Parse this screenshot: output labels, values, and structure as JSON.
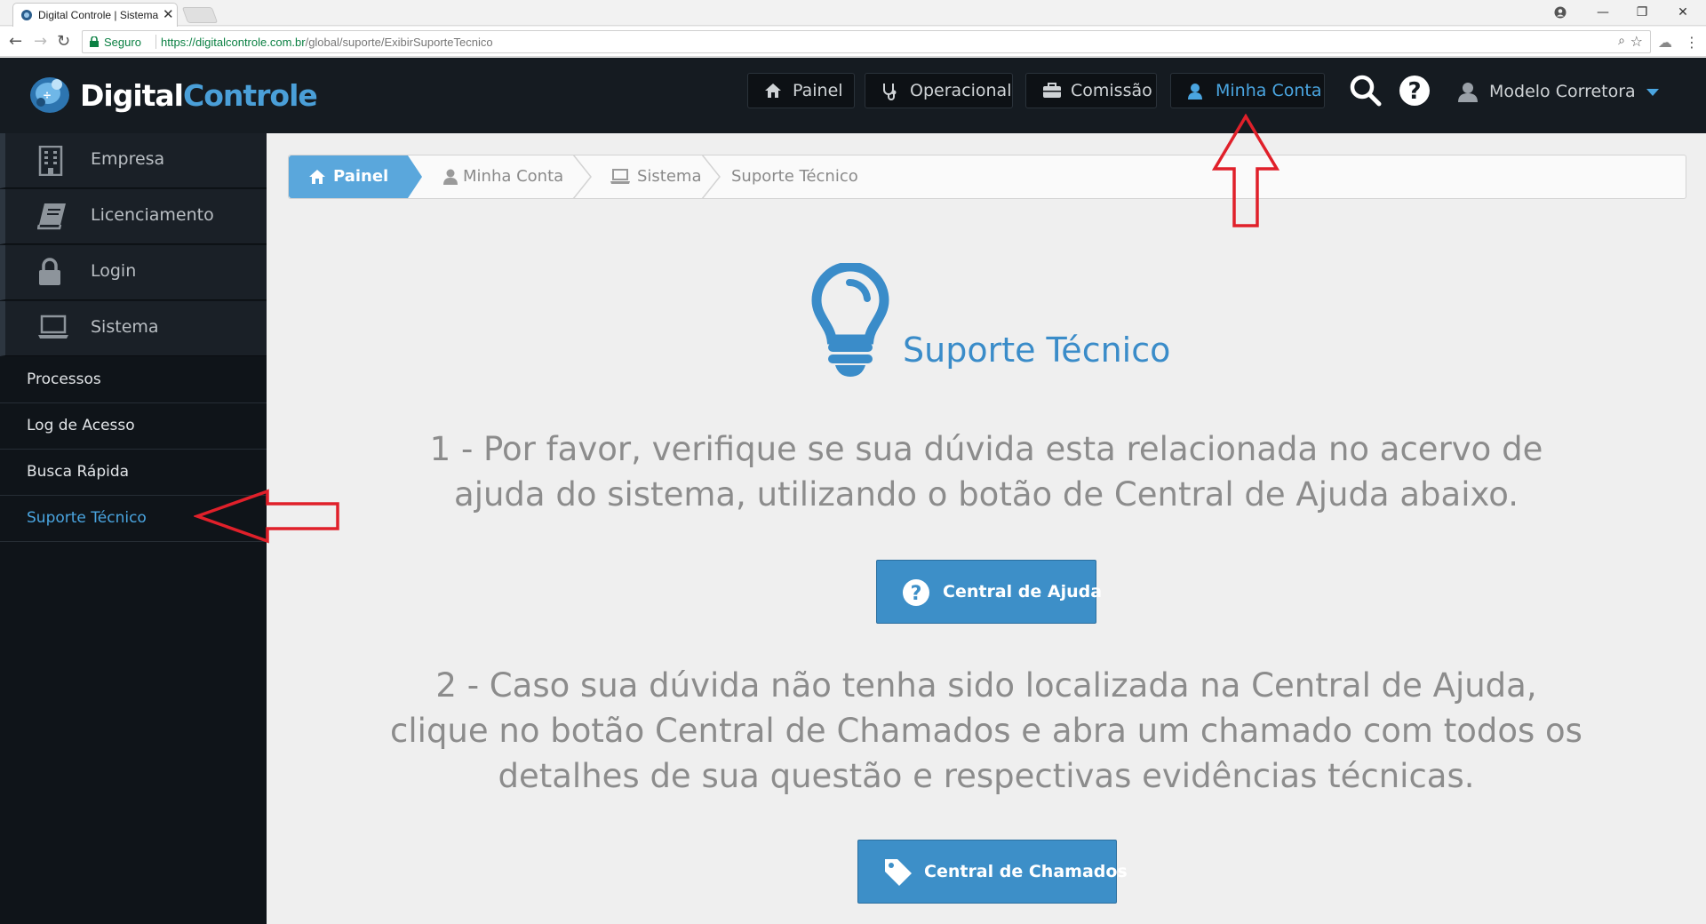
{
  "browser": {
    "tab_title": "Digital Controle | Sistema",
    "tab_close": "✕",
    "secure_label": "Seguro",
    "url_host": "https://digitalcontrole.com.br",
    "url_path": "/global/suporte/ExibirSuporteTecnico"
  },
  "app": {
    "logo_part1": "Digital",
    "logo_part2": "Controle",
    "nav": [
      {
        "label": "Painel",
        "icon": "home-icon"
      },
      {
        "label": "Operacional",
        "icon": "stethoscope-icon"
      },
      {
        "label": "Comissão",
        "icon": "briefcase-icon"
      },
      {
        "label": "Minha Conta",
        "icon": "user-icon",
        "active": true
      }
    ],
    "user_name": "Modelo Corretora"
  },
  "sidebar": {
    "big_items": [
      {
        "label": "Empresa",
        "icon": "building-icon"
      },
      {
        "label": "Licenciamento",
        "icon": "book-icon"
      },
      {
        "label": "Login",
        "icon": "lock-icon"
      },
      {
        "label": "Sistema",
        "icon": "laptop-icon"
      }
    ],
    "small_items": [
      {
        "label": "Processos"
      },
      {
        "label": "Log de Acesso"
      },
      {
        "label": "Busca Rápida"
      },
      {
        "label": "Suporte Técnico",
        "active": true
      }
    ]
  },
  "breadcrumb": {
    "home": "Painel",
    "items": [
      "Minha Conta",
      "Sistema",
      "Suporte Técnico"
    ]
  },
  "page": {
    "title": "Suporte Técnico",
    "step1_lines": [
      "1 - Por favor, verifique se sua dúvida esta relacionada no acervo de",
      "ajuda do sistema, utilizando o botão de Central de Ajuda abaixo."
    ],
    "help_button": "Central de Ajuda",
    "step2_lines": [
      "2 - Caso sua dúvida não tenha sido localizada na Central de Ajuda,",
      "clique no botão Central de Chamados e abra um chamado com todos os",
      "detalhes de sua questão e respectivas evidências técnicas."
    ],
    "tickets_button": "Central de Chamados"
  },
  "colors": {
    "accent": "#4aa5e0",
    "header_bg": "#151b21",
    "button_blue": "#3d8fc8",
    "annotation_red": "#e0202a"
  }
}
